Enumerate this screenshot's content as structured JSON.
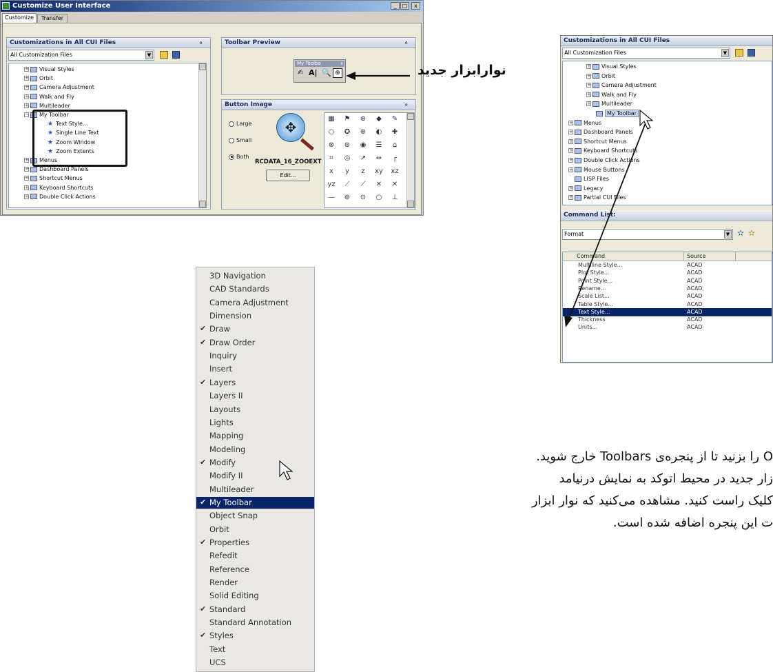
{
  "cui_window": {
    "title": "Customize User Interface",
    "controls": [
      "_",
      "□",
      "x"
    ],
    "tabs": [
      "Customize",
      "Transfer"
    ],
    "customizations_panel": {
      "header": "Customizations in All CUI Files",
      "dropdown": "All Customization Files",
      "tree": [
        {
          "label": "Visual Styles",
          "expander": "+"
        },
        {
          "label": "Orbit",
          "expander": "+"
        },
        {
          "label": "Camera Adjustment",
          "expander": "+"
        },
        {
          "label": "Walk and Fly",
          "expander": "+"
        },
        {
          "label": "Multileader",
          "expander": "+"
        },
        {
          "label": "My Toolbar",
          "expander": "−"
        },
        {
          "label": "Text Style...",
          "child": true
        },
        {
          "label": "Single Line Text",
          "child": true
        },
        {
          "label": "Zoom Window",
          "child": true
        },
        {
          "label": "Zoom Extents",
          "child": true
        },
        {
          "label": "Menus",
          "expander": "+"
        },
        {
          "label": "Dashboard Panels",
          "expander": "+"
        },
        {
          "label": "Shortcut Menus",
          "expander": "+"
        },
        {
          "label": "Keyboard Shortcuts",
          "expander": "+"
        },
        {
          "label": "Double Click Actions",
          "expander": "+"
        }
      ]
    },
    "toolbar_preview": {
      "header": "Toolbar Preview",
      "mini_title": "My Toolba",
      "mini_close": "x"
    },
    "button_image": {
      "header": "Button Image",
      "options": [
        "Large",
        "Small",
        "Both"
      ],
      "selected": "Both",
      "resource_name": "RCDATA_16_ZOOEXT",
      "edit_label": "Edit...",
      "icon_glyphs": [
        "▦",
        "⚑",
        "⊕",
        "◆",
        "✎",
        "○",
        "✪",
        "⊕",
        "◐",
        "✚",
        "⊗",
        "⊛",
        "◉",
        "☰",
        "⌂",
        "⌗",
        "◎",
        "↗",
        "⇔",
        "┌",
        "x",
        "y",
        "z",
        "xy",
        "xz",
        "yz",
        "⟋",
        "⟋",
        "✕",
        "✕",
        "—",
        "⊚",
        "⊙",
        "○",
        "⊥"
      ]
    },
    "collapse_glyph": "«"
  },
  "annotation_new_toolbar": "نوارابزار جدید",
  "cui_panel_right": {
    "header": "Customizations in All CUI Files",
    "dropdown": "All Customization Files",
    "tree": [
      {
        "label": "Visual Styles",
        "expander": "+"
      },
      {
        "label": "Orbit",
        "expander": "+"
      },
      {
        "label": "Camera Adjustment",
        "expander": "+"
      },
      {
        "label": "Walk and Fly",
        "expander": "+"
      },
      {
        "label": "Multileader",
        "expander": "+"
      },
      {
        "label": "My Toolbar",
        "highlight": true
      },
      {
        "label": "Menus",
        "expander": "+"
      },
      {
        "label": "Dashboard Panels",
        "expander": "+"
      },
      {
        "label": "Shortcut Menus",
        "expander": "+"
      },
      {
        "label": "Keyboard Shortcuts",
        "expander": "+"
      },
      {
        "label": "Double Click Actions",
        "expander": "+"
      },
      {
        "label": "Mouse Buttons",
        "expander": "+"
      },
      {
        "label": "LISP Files",
        "expander": ""
      },
      {
        "label": "Legacy",
        "expander": "+"
      },
      {
        "label": "Partial CUI Files",
        "expander": "+"
      }
    ],
    "command_list": {
      "header": "Command List:",
      "filter": "Format",
      "columns": [
        "Command",
        "Source"
      ],
      "rows": [
        [
          "Multiline Style...",
          "ACAD"
        ],
        [
          "Plot Style...",
          "ACAD"
        ],
        [
          "Point Style...",
          "ACAD"
        ],
        [
          "Rename...",
          "ACAD"
        ],
        [
          "Scale List...",
          "ACAD"
        ],
        [
          "Table Style...",
          "ACAD"
        ],
        [
          "Text Style...",
          "ACAD"
        ],
        [
          "Thickness",
          "ACAD"
        ],
        [
          "Units...",
          "ACAD"
        ]
      ],
      "selected_row": 6
    }
  },
  "toolbars_menu": {
    "items": [
      {
        "label": "3D Navigation",
        "checked": false
      },
      {
        "label": "CAD Standards",
        "checked": false
      },
      {
        "label": "Camera Adjustment",
        "checked": false
      },
      {
        "label": "Dimension",
        "checked": false
      },
      {
        "label": "Draw",
        "checked": true
      },
      {
        "label": "Draw Order",
        "checked": true
      },
      {
        "label": "Inquiry",
        "checked": false
      },
      {
        "label": "Insert",
        "checked": false
      },
      {
        "label": "Layers",
        "checked": true
      },
      {
        "label": "Layers II",
        "checked": false
      },
      {
        "label": "Layouts",
        "checked": false
      },
      {
        "label": "Lights",
        "checked": false
      },
      {
        "label": "Mapping",
        "checked": false
      },
      {
        "label": "Modeling",
        "checked": false
      },
      {
        "label": "Modify",
        "checked": true
      },
      {
        "label": "Modify II",
        "checked": false
      },
      {
        "label": "Multileader",
        "checked": false
      },
      {
        "label": "My Toolbar",
        "checked": true
      },
      {
        "label": "Object Snap",
        "checked": false
      },
      {
        "label": "Orbit",
        "checked": false
      },
      {
        "label": "Properties",
        "checked": true
      },
      {
        "label": "Refedit",
        "checked": false
      },
      {
        "label": "Reference",
        "checked": false
      },
      {
        "label": "Render",
        "checked": false
      },
      {
        "label": "Solid Editing",
        "checked": false
      },
      {
        "label": "Standard",
        "checked": true
      },
      {
        "label": "Standard Annotation",
        "checked": false
      },
      {
        "label": "Styles",
        "checked": true
      },
      {
        "label": "Text",
        "checked": false
      },
      {
        "label": "UCS",
        "checked": false
      }
    ],
    "highlighted_index": 17,
    "check_glyph": "✔"
  },
  "persian_text": [
    "O را بزنید تا از پنجره‌ی Toolbars خارج شوید.",
    "زار جدید در محیط اتوکد به نمایش درنیامد",
    "کلیک راست کنید. مشاهده می‌کنید که نوار ابزار",
    "ت این پنجره اضافه شده است."
  ]
}
